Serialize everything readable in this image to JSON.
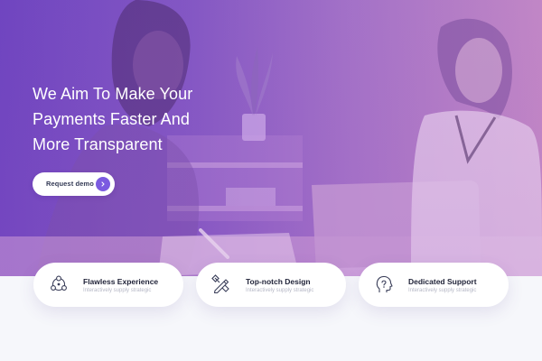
{
  "hero": {
    "headline": [
      "We Aim To Make Your",
      "Payments Faster And",
      "More Transparent"
    ],
    "cta_label": "Request demo",
    "cta_icon": "chevron-right-icon",
    "accent_color": "#7b5be0"
  },
  "features": [
    {
      "title": "Flawless Experience",
      "subtitle": "Interactively supply strategic",
      "icon": "network-nodes-icon"
    },
    {
      "title": "Top-notch Design",
      "subtitle": "Interactively supply strategic",
      "icon": "design-tools-icon"
    },
    {
      "title": "Dedicated Support",
      "subtitle": "Interactively supply strategic",
      "icon": "support-head-icon"
    }
  ]
}
